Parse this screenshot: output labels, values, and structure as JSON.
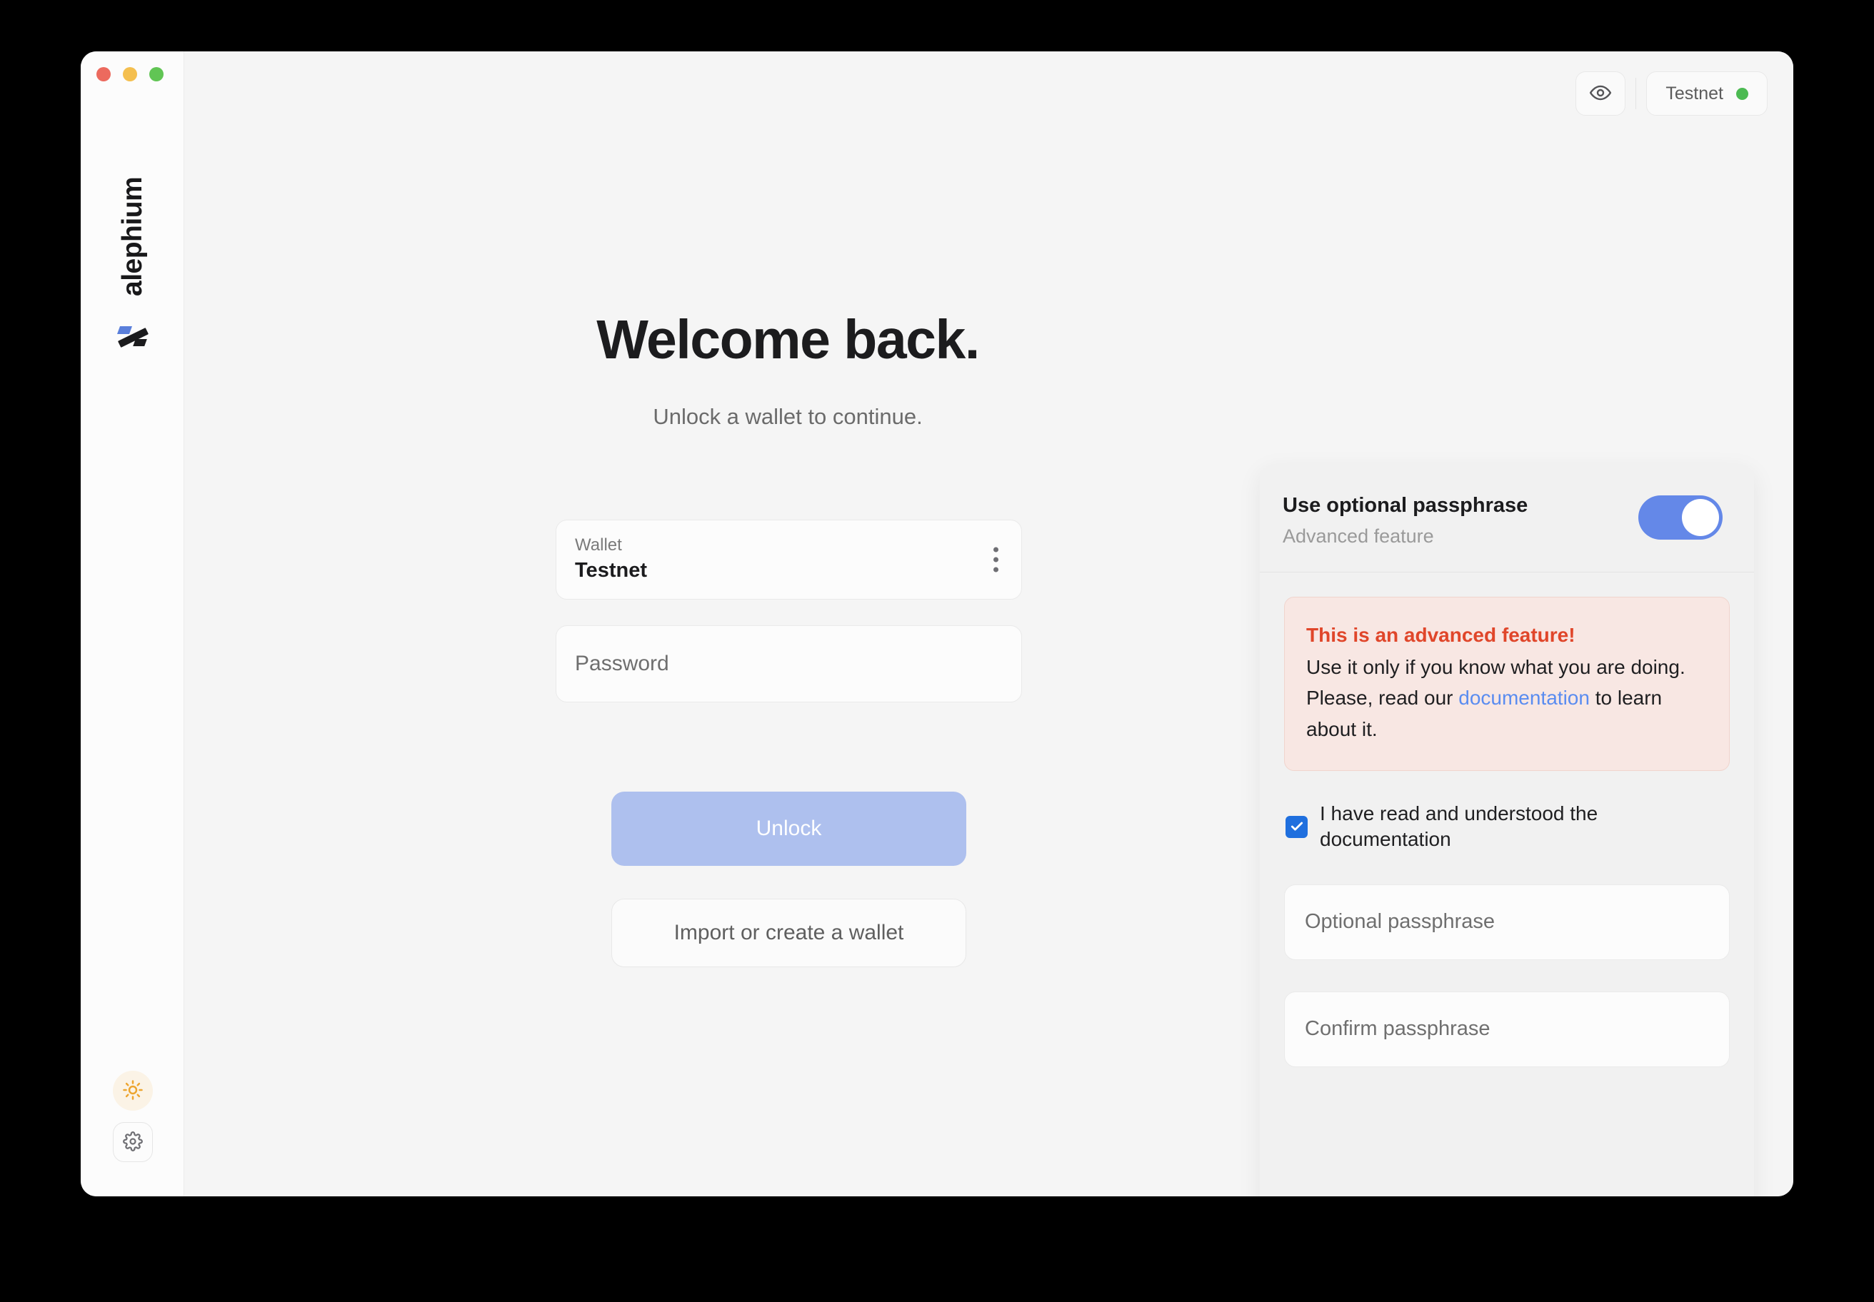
{
  "window": {
    "traffic_lights": [
      {
        "name": "close",
        "color": "#ec6a5e"
      },
      {
        "name": "minimize",
        "color": "#f4bf4f"
      },
      {
        "name": "maximize",
        "color": "#61c554"
      }
    ]
  },
  "sidebar": {
    "brand_name": "alephium",
    "logo_icon": "alephium-logo-icon",
    "theme_icon": "sun-icon",
    "settings_icon": "gear-icon"
  },
  "topbar": {
    "eye_icon": "eye-icon",
    "network_label": "Testnet",
    "network_status_color": "#4cba52"
  },
  "main": {
    "title": "Welcome back.",
    "subtitle": "Unlock a wallet to continue.",
    "wallet": {
      "label": "Wallet",
      "value": "Testnet",
      "menu_icon": "kebab-menu-icon"
    },
    "password": {
      "placeholder": "Password",
      "value": ""
    },
    "unlock_label": "Unlock",
    "import_label": "Import or create a wallet",
    "unlock_color": "#aec0ee"
  },
  "passphrase_panel": {
    "title": "Use optional passphrase",
    "subtitle": "Advanced feature",
    "toggle_on": true,
    "toggle_color": "#6488e8",
    "warning": {
      "title": "This is an advanced feature!",
      "text_before": "Use it only if you know what you are doing. Please, read our ",
      "link_label": "documentation",
      "text_after": " to learn about it.",
      "background": "#f8e7e3",
      "title_color": "#e0462a",
      "link_color": "#5a8cf0"
    },
    "acknowledgement": {
      "label": "I have read and understood the documentation",
      "checked": true,
      "check_color": "#1f6fde"
    },
    "passphrase": {
      "placeholder": "Optional passphrase",
      "value": ""
    },
    "confirm_passphrase": {
      "placeholder": "Confirm passphrase",
      "value": ""
    }
  }
}
